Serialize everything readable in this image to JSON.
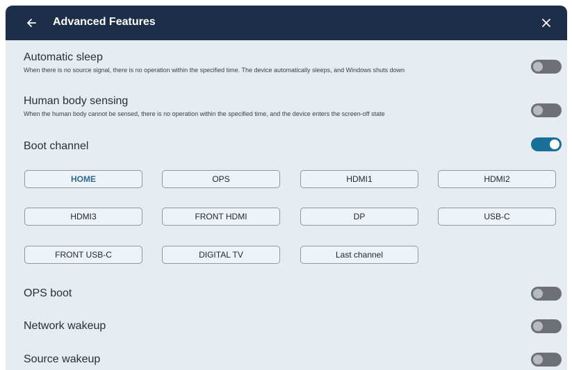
{
  "header": {
    "title": "Advanced Features",
    "back_icon": "arrow-left-icon",
    "close_icon": "close-icon"
  },
  "settings": {
    "automatic_sleep": {
      "title": "Automatic sleep",
      "description": "When there is no source signal, there is no operation within the specified time. The device automatically sleeps, and Windows shuts down",
      "enabled": false
    },
    "human_body_sensing": {
      "title": "Human body sensing",
      "description": "When the human body cannot be sensed, there is no operation within the specified time, and the device enters the screen-off state",
      "enabled": false
    },
    "boot_channel": {
      "title": "Boot channel",
      "enabled": true,
      "selected": "HOME",
      "options": [
        "HOME",
        "OPS",
        "HDMI1",
        "HDMI2",
        "HDMI3",
        "FRONT HDMI",
        "DP",
        "USB-C",
        "FRONT USB-C",
        "DIGITAL TV",
        "Last channel"
      ]
    },
    "ops_boot": {
      "title": "OPS boot",
      "enabled": false
    },
    "network_wakeup": {
      "title": "Network wakeup",
      "enabled": false
    },
    "source_wakeup": {
      "title": "Source wakeup",
      "enabled": false
    }
  },
  "colors": {
    "header_bg": "#1d2f48",
    "panel_bg": "#e6ecf2",
    "accent": "#1a6f96",
    "toggle_off": "#6d7177"
  }
}
